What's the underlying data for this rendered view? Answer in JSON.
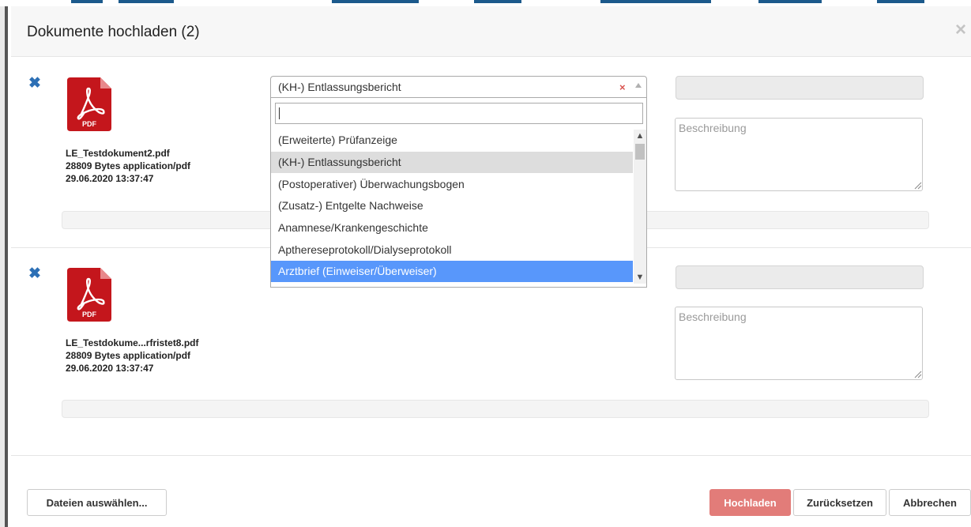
{
  "modal": {
    "title": "Dokumente hochladen (2)",
    "close_label": "×"
  },
  "files": [
    {
      "remove_label": "✖",
      "filename": "LE_Testdokument2.pdf",
      "size_type": "28809 Bytes application/pdf",
      "date": "29.06.2020 13:37:47",
      "description_placeholder": "Beschreibung",
      "icon": "pdf-file-icon",
      "icon_label": "PDF"
    },
    {
      "remove_label": "✖",
      "filename": "LE_Testdokume...rfristet8.pdf",
      "size_type": "28809 Bytes application/pdf",
      "date": "29.06.2020 13:37:47",
      "description_placeholder": "Beschreibung",
      "icon": "pdf-file-icon",
      "icon_label": "PDF"
    }
  ],
  "select": {
    "value": "(KH-) Entlassungsbericht",
    "clear_label": "×",
    "search_value": "",
    "options": [
      "(Erweiterte) Prüfanzeige",
      "(KH-) Entlassungsbericht",
      "(Postoperativer) Überwachungsbogen",
      "(Zusatz-) Entgelte Nachweise",
      "Anamnese/Krankengeschichte",
      "Apthereseprotokoll/Dialyseprotokoll",
      "Arztbrief (Einweiser/Überweiser)"
    ],
    "hovered_option": "(KH-) Entlassungsbericht",
    "active_option": "Arztbrief (Einweiser/Überweiser)"
  },
  "footer": {
    "choose_files_label": "Dateien auswählen...",
    "upload_label": "Hochladen",
    "reset_label": "Zurücksetzen",
    "cancel_label": "Abbrechen"
  },
  "colors": {
    "accent": "#2c6fb5",
    "primary_button": "#e27c79",
    "active_option": "#5897fb",
    "pdf_red": "#c4161c"
  }
}
